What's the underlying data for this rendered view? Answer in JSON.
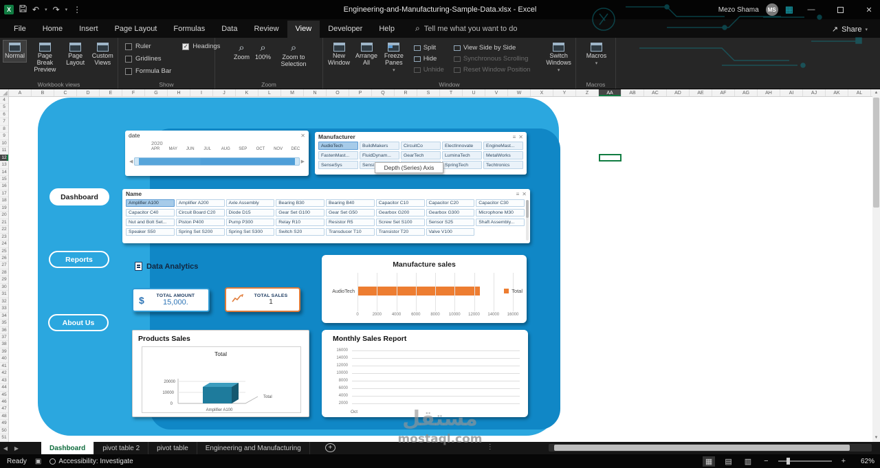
{
  "title_bar": {
    "title": "Engineering-and-Manufacturing-Sample-Data.xlsx - Excel",
    "user_name": "Mezo Shama",
    "avatar_initials": "MS"
  },
  "menu_bar": {
    "tabs": [
      "File",
      "Home",
      "Insert",
      "Page Layout",
      "Formulas",
      "Data",
      "Review",
      "View",
      "Developer",
      "Help"
    ],
    "active_tab": "View",
    "tell_me": "Tell me what you want to do",
    "share": "Share"
  },
  "ribbon": {
    "workbook_views": {
      "label": "Workbook views",
      "buttons": [
        "Normal",
        "Page Break Preview",
        "Page Layout",
        "Custom Views"
      ],
      "active": "Normal"
    },
    "show": {
      "label": "Show",
      "checkboxes": [
        {
          "label": "Ruler",
          "checked": false
        },
        {
          "label": "Gridlines",
          "checked": false
        },
        {
          "label": "Formula Bar",
          "checked": false
        },
        {
          "label": "Headings",
          "checked": true
        }
      ]
    },
    "zoom": {
      "label": "Zoom",
      "buttons": [
        "Zoom",
        "100%",
        "Zoom to Selection"
      ]
    },
    "window": {
      "label": "Window",
      "big_buttons": [
        "New Window",
        "Arrange All",
        "Freeze Panes"
      ],
      "small_buttons": [
        {
          "label": "Split",
          "enabled": true
        },
        {
          "label": "Hide",
          "enabled": true
        },
        {
          "label": "Unhide",
          "enabled": false
        },
        {
          "label": "View Side by Side",
          "enabled": true
        },
        {
          "label": "Synchronous Scrolling",
          "enabled": false
        },
        {
          "label": "Reset Window Position",
          "enabled": false
        }
      ],
      "switch_windows": "Switch Windows"
    },
    "macros": {
      "label": "Macros",
      "button": "Macros"
    }
  },
  "grid": {
    "columns": [
      "A",
      "B",
      "C",
      "D",
      "E",
      "F",
      "G",
      "H",
      "I",
      "J",
      "K",
      "L",
      "M",
      "N",
      "O",
      "P",
      "Q",
      "R",
      "S",
      "T",
      "U",
      "V",
      "W",
      "X",
      "Y",
      "Z",
      "AA",
      "AB",
      "AC",
      "AD",
      "AE",
      "AF",
      "AG",
      "AH",
      "AI",
      "AJ",
      "AK",
      "AL"
    ],
    "selected_column": "AA",
    "row_start": 4,
    "row_end": 51,
    "selected_row": 12,
    "selected_cell": "AA12"
  },
  "dashboard": {
    "nav": [
      {
        "label": "Dashboard",
        "active": true
      },
      {
        "label": "Reports",
        "active": false
      },
      {
        "label": "About Us",
        "active": false
      }
    ],
    "date_slicer": {
      "title": "date",
      "year": "2020",
      "months": [
        "APR",
        "MAY",
        "JUN",
        "JUL",
        "AUG",
        "SEP",
        "OCT",
        "NOV",
        "DEC"
      ]
    },
    "manufacturer_slicer": {
      "title": "Manufacturer",
      "tooltip": "Depth (Series) Axis",
      "items": [
        {
          "label": "AudioTech",
          "selected": true
        },
        {
          "label": "BuildMakers",
          "selected": false
        },
        {
          "label": "CircuitCo",
          "selected": false
        },
        {
          "label": "ElectInnovate",
          "selected": false
        },
        {
          "label": "EngineMast...",
          "selected": false
        },
        {
          "label": "FastenMast...",
          "selected": false
        },
        {
          "label": "FluidDynam...",
          "selected": false
        },
        {
          "label": "GearTech",
          "selected": false
        },
        {
          "label": "LuminaTech",
          "selected": false
        },
        {
          "label": "MetalWorks",
          "selected": false
        },
        {
          "label": "SenseSys",
          "selected": false
        },
        {
          "label": "Sensi",
          "selected": false
        },
        {
          "label": "",
          "selected": false
        },
        {
          "label": "SpringTech",
          "selected": false
        },
        {
          "label": "Techtronics",
          "selected": false
        }
      ]
    },
    "name_slicer": {
      "title": "Name",
      "selected": "Amplifier A100",
      "items": [
        "Amplifier A100",
        "Amplifier A200",
        "Axle Assembly",
        "Bearing B30",
        "Bearing B40",
        "Capacitor C10",
        "Capacitor C20",
        "Capacitor C30",
        "Capacitor C40",
        "Circuit Board C20",
        "Diode D15",
        "Gear Set G100",
        "Gear Set G50",
        "Gearbox G200",
        "Gearbox G300",
        "Microphone M30",
        "Nut and Bolt Set...",
        "Piston P400",
        "Pump P300",
        "Relay R10",
        "Resistor R5",
        "Screw Set S100",
        "Sensor S25",
        "Shaft Assembly...",
        "Speaker S50",
        "Spring Set S200",
        "Spring Set S300",
        "Switch S20",
        "Transducer T10",
        "Transistor T20",
        "Valve V100"
      ]
    },
    "analytics": {
      "title": "Data Analytics",
      "cards": [
        {
          "label": "TOTAL AMOUNT",
          "value": "15,000.",
          "accent": "#2e9bd6"
        },
        {
          "label": "TOTAL SALES",
          "value": "1",
          "accent": "#e07b39"
        }
      ]
    }
  },
  "chart_data": [
    {
      "type": "bar",
      "orientation": "horizontal",
      "title": "Manufacture sales",
      "categories": [
        "AudioTech"
      ],
      "values": [
        12600
      ],
      "xlim": [
        0,
        16000
      ],
      "xticks": [
        0,
        2000,
        4000,
        6000,
        8000,
        10000,
        12000,
        14000,
        16000
      ],
      "legend": [
        "Total"
      ],
      "legend_position": "right",
      "series_color": "#ED7D31",
      "grid": true
    },
    {
      "type": "bar",
      "style": "3d",
      "title": "Products Sales",
      "categories": [
        "Amplifier A100"
      ],
      "series": [
        {
          "name": "Total",
          "values": [
            15000
          ]
        }
      ],
      "yticks": [
        0,
        10000,
        20000
      ],
      "ylim": [
        0,
        20000
      ],
      "series_color": "#1E7B9C"
    },
    {
      "type": "line",
      "title": "Monthly Sales Report",
      "categories": [
        "Oct"
      ],
      "yticks": [
        2000,
        4000,
        6000,
        8000,
        10000,
        12000,
        14000,
        16000
      ],
      "series": [],
      "grid": true
    }
  ],
  "sheet_tabs": {
    "tabs": [
      "Dashboard",
      "pivot table 2",
      "pivot table",
      "Engineering and Manufacturing"
    ],
    "active": "Dashboard"
  },
  "status_bar": {
    "ready": "Ready",
    "accessibility": "Accessibility: Investigate",
    "zoom": "62%"
  },
  "watermark": {
    "arabic": "مستقل",
    "latin": "mostaql.com"
  }
}
